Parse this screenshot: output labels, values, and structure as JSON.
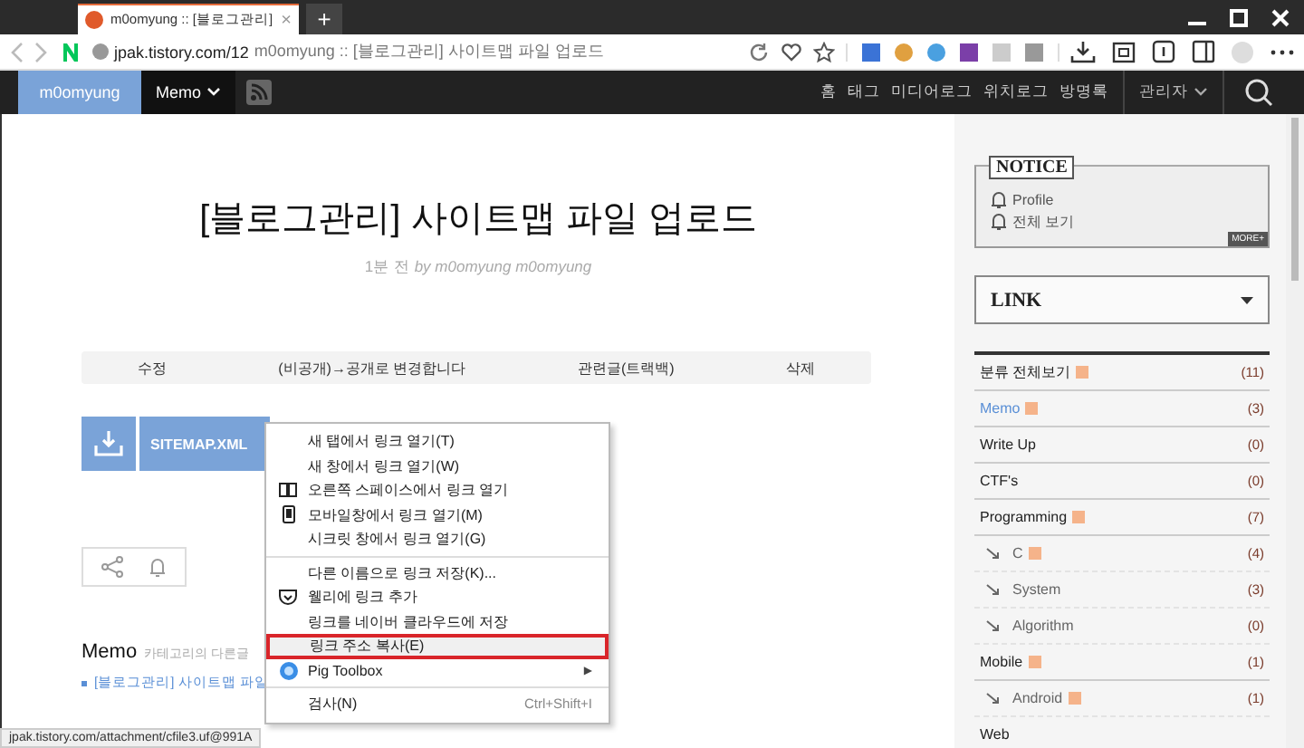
{
  "browser": {
    "tab": {
      "title": "m0omyung :: [블로그관리]",
      "close": "×",
      "selected": true
    },
    "new_tab": "+",
    "url": "jpak.tistory.com/12",
    "page_title": "m0omyung :: [블로그관리] 사이트맵 파일 업로드"
  },
  "blog_nav": {
    "brand": "m0omyung",
    "category": "Memo",
    "links": [
      "홈",
      "태그",
      "미디어로그",
      "위치로그",
      "방명록"
    ],
    "admin": "관리자"
  },
  "post": {
    "title": "[블로그관리] 사이트맵 파일 업로드",
    "time": "1분 전",
    "author": "by m0omyung m0omyung",
    "actions": [
      "수정",
      "(비공개)→공개로 변경합니다",
      "관련글(트랙백)",
      "삭제"
    ],
    "attachment": "SITEMAP.XML",
    "related_heading": "Memo",
    "related_sub": "카테고리의 다른글",
    "related": [
      "[블로그관리] 사이트맵 파일"
    ]
  },
  "context_menu": [
    {
      "kind": "item",
      "label": "새 탭에서 링크 열기(T)",
      "selected": false
    },
    {
      "kind": "item",
      "label": "새 창에서 링크 열기(W)",
      "selected": false
    },
    {
      "kind": "book",
      "label": "오른쪽 스페이스에서 링크 열기",
      "selected": false
    },
    {
      "kind": "phone",
      "label": "모바일창에서 링크 열기(M)",
      "selected": false
    },
    {
      "kind": "item",
      "label": "시크릿 창에서 링크 열기(G)",
      "selected": false
    },
    {
      "kind": "separator"
    },
    {
      "kind": "item",
      "label": "다른 이름으로 링크 저장(K)...",
      "selected": false
    },
    {
      "kind": "pocket",
      "label": "웰리에 링크 추가",
      "selected": false
    },
    {
      "kind": "item",
      "label": "링크를 네이버 클라우드에 저장",
      "selected": false
    },
    {
      "kind": "item",
      "label": "링크 주소 복사(E)",
      "selected": true
    },
    {
      "kind": "submenu",
      "label": "Pig Toolbox",
      "arrow": "▶",
      "selected": false
    },
    {
      "kind": "separator"
    },
    {
      "kind": "item",
      "label": "검사(N)",
      "shortcut": "Ctrl+Shift+I",
      "selected": false
    }
  ],
  "status_bar": "jpak.tistory.com/attachment/cfile3.uf@991A",
  "sidebar": {
    "notice": {
      "title": "NOTICE",
      "items": [
        "Profile",
        "전체 보기"
      ],
      "more": "MORE+"
    },
    "link_box": {
      "title": "LINK"
    },
    "categories": [
      {
        "name": "분류 전체보기",
        "count": "(11)",
        "rss": true,
        "selected": false
      },
      {
        "name": "Memo",
        "count": "(3)",
        "rss": true,
        "selected": true
      },
      {
        "name": "Write Up",
        "count": "(0)",
        "rss": false,
        "selected": false
      },
      {
        "name": "CTF's",
        "count": "(0)",
        "rss": false,
        "selected": false
      },
      {
        "name": "Programming",
        "count": "(7)",
        "rss": true,
        "selected": false,
        "children": [
          {
            "name": "C",
            "count": "(4)",
            "rss": true,
            "selected": false
          },
          {
            "name": "System",
            "count": "(3)",
            "rss": false,
            "selected": false
          },
          {
            "name": "Algorithm",
            "count": "(0)",
            "rss": false,
            "selected": false
          }
        ]
      },
      {
        "name": "Mobile",
        "count": "(1)",
        "rss": true,
        "selected": false,
        "children": [
          {
            "name": "Android",
            "count": "(1)",
            "rss": true,
            "selected": false
          }
        ]
      },
      {
        "name": "Web",
        "rss": false,
        "selected": false
      }
    ]
  }
}
